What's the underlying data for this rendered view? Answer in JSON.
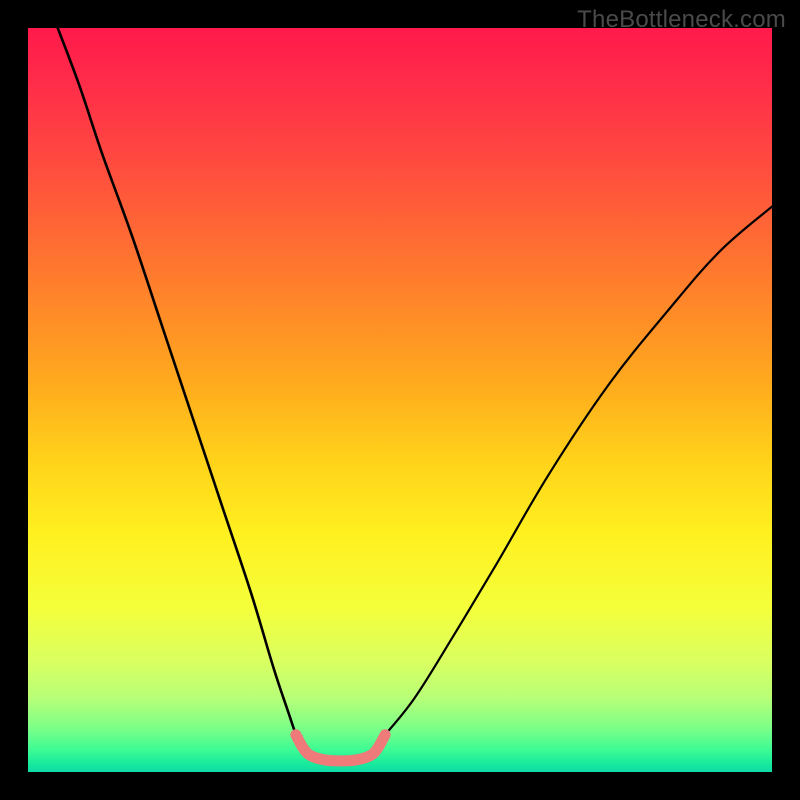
{
  "watermark": {
    "text": "TheBottleneck.com"
  },
  "chart_data": {
    "type": "line",
    "title": "",
    "xlabel": "",
    "ylabel": "",
    "xlim": [
      0,
      100
    ],
    "ylim": [
      0,
      100
    ],
    "annotations": [
      "TheBottleneck.com"
    ],
    "series": [
      {
        "name": "left-descend-curve",
        "color": "#000000",
        "x": [
          4,
          7,
          10,
          14,
          18,
          22,
          26,
          30,
          33,
          35,
          36
        ],
        "y": [
          100,
          92,
          83,
          72,
          60,
          48,
          36,
          24,
          14,
          8,
          5
        ]
      },
      {
        "name": "right-ascend-curve",
        "color": "#000000",
        "x": [
          48,
          52,
          57,
          63,
          70,
          78,
          86,
          93,
          100
        ],
        "y": [
          5,
          10,
          18,
          28,
          40,
          52,
          62,
          70,
          76
        ]
      },
      {
        "name": "valley-overlay",
        "color": "#ee7a7a",
        "x": [
          36,
          37,
          38,
          40,
          42,
          44,
          46,
          47,
          48
        ],
        "y": [
          5.0,
          3.2,
          2.2,
          1.6,
          1.5,
          1.6,
          2.2,
          3.2,
          5.0
        ]
      }
    ],
    "gradient_stops": [
      {
        "pos": 0.0,
        "color": "#ff1a4b"
      },
      {
        "pos": 0.18,
        "color": "#ff4a3f"
      },
      {
        "pos": 0.38,
        "color": "#ff8a28"
      },
      {
        "pos": 0.58,
        "color": "#ffd21a"
      },
      {
        "pos": 0.78,
        "color": "#f4ff3a"
      },
      {
        "pos": 0.9,
        "color": "#b8ff77"
      },
      {
        "pos": 0.97,
        "color": "#3dfb94"
      },
      {
        "pos": 1.0,
        "color": "#10d9a5"
      }
    ]
  }
}
